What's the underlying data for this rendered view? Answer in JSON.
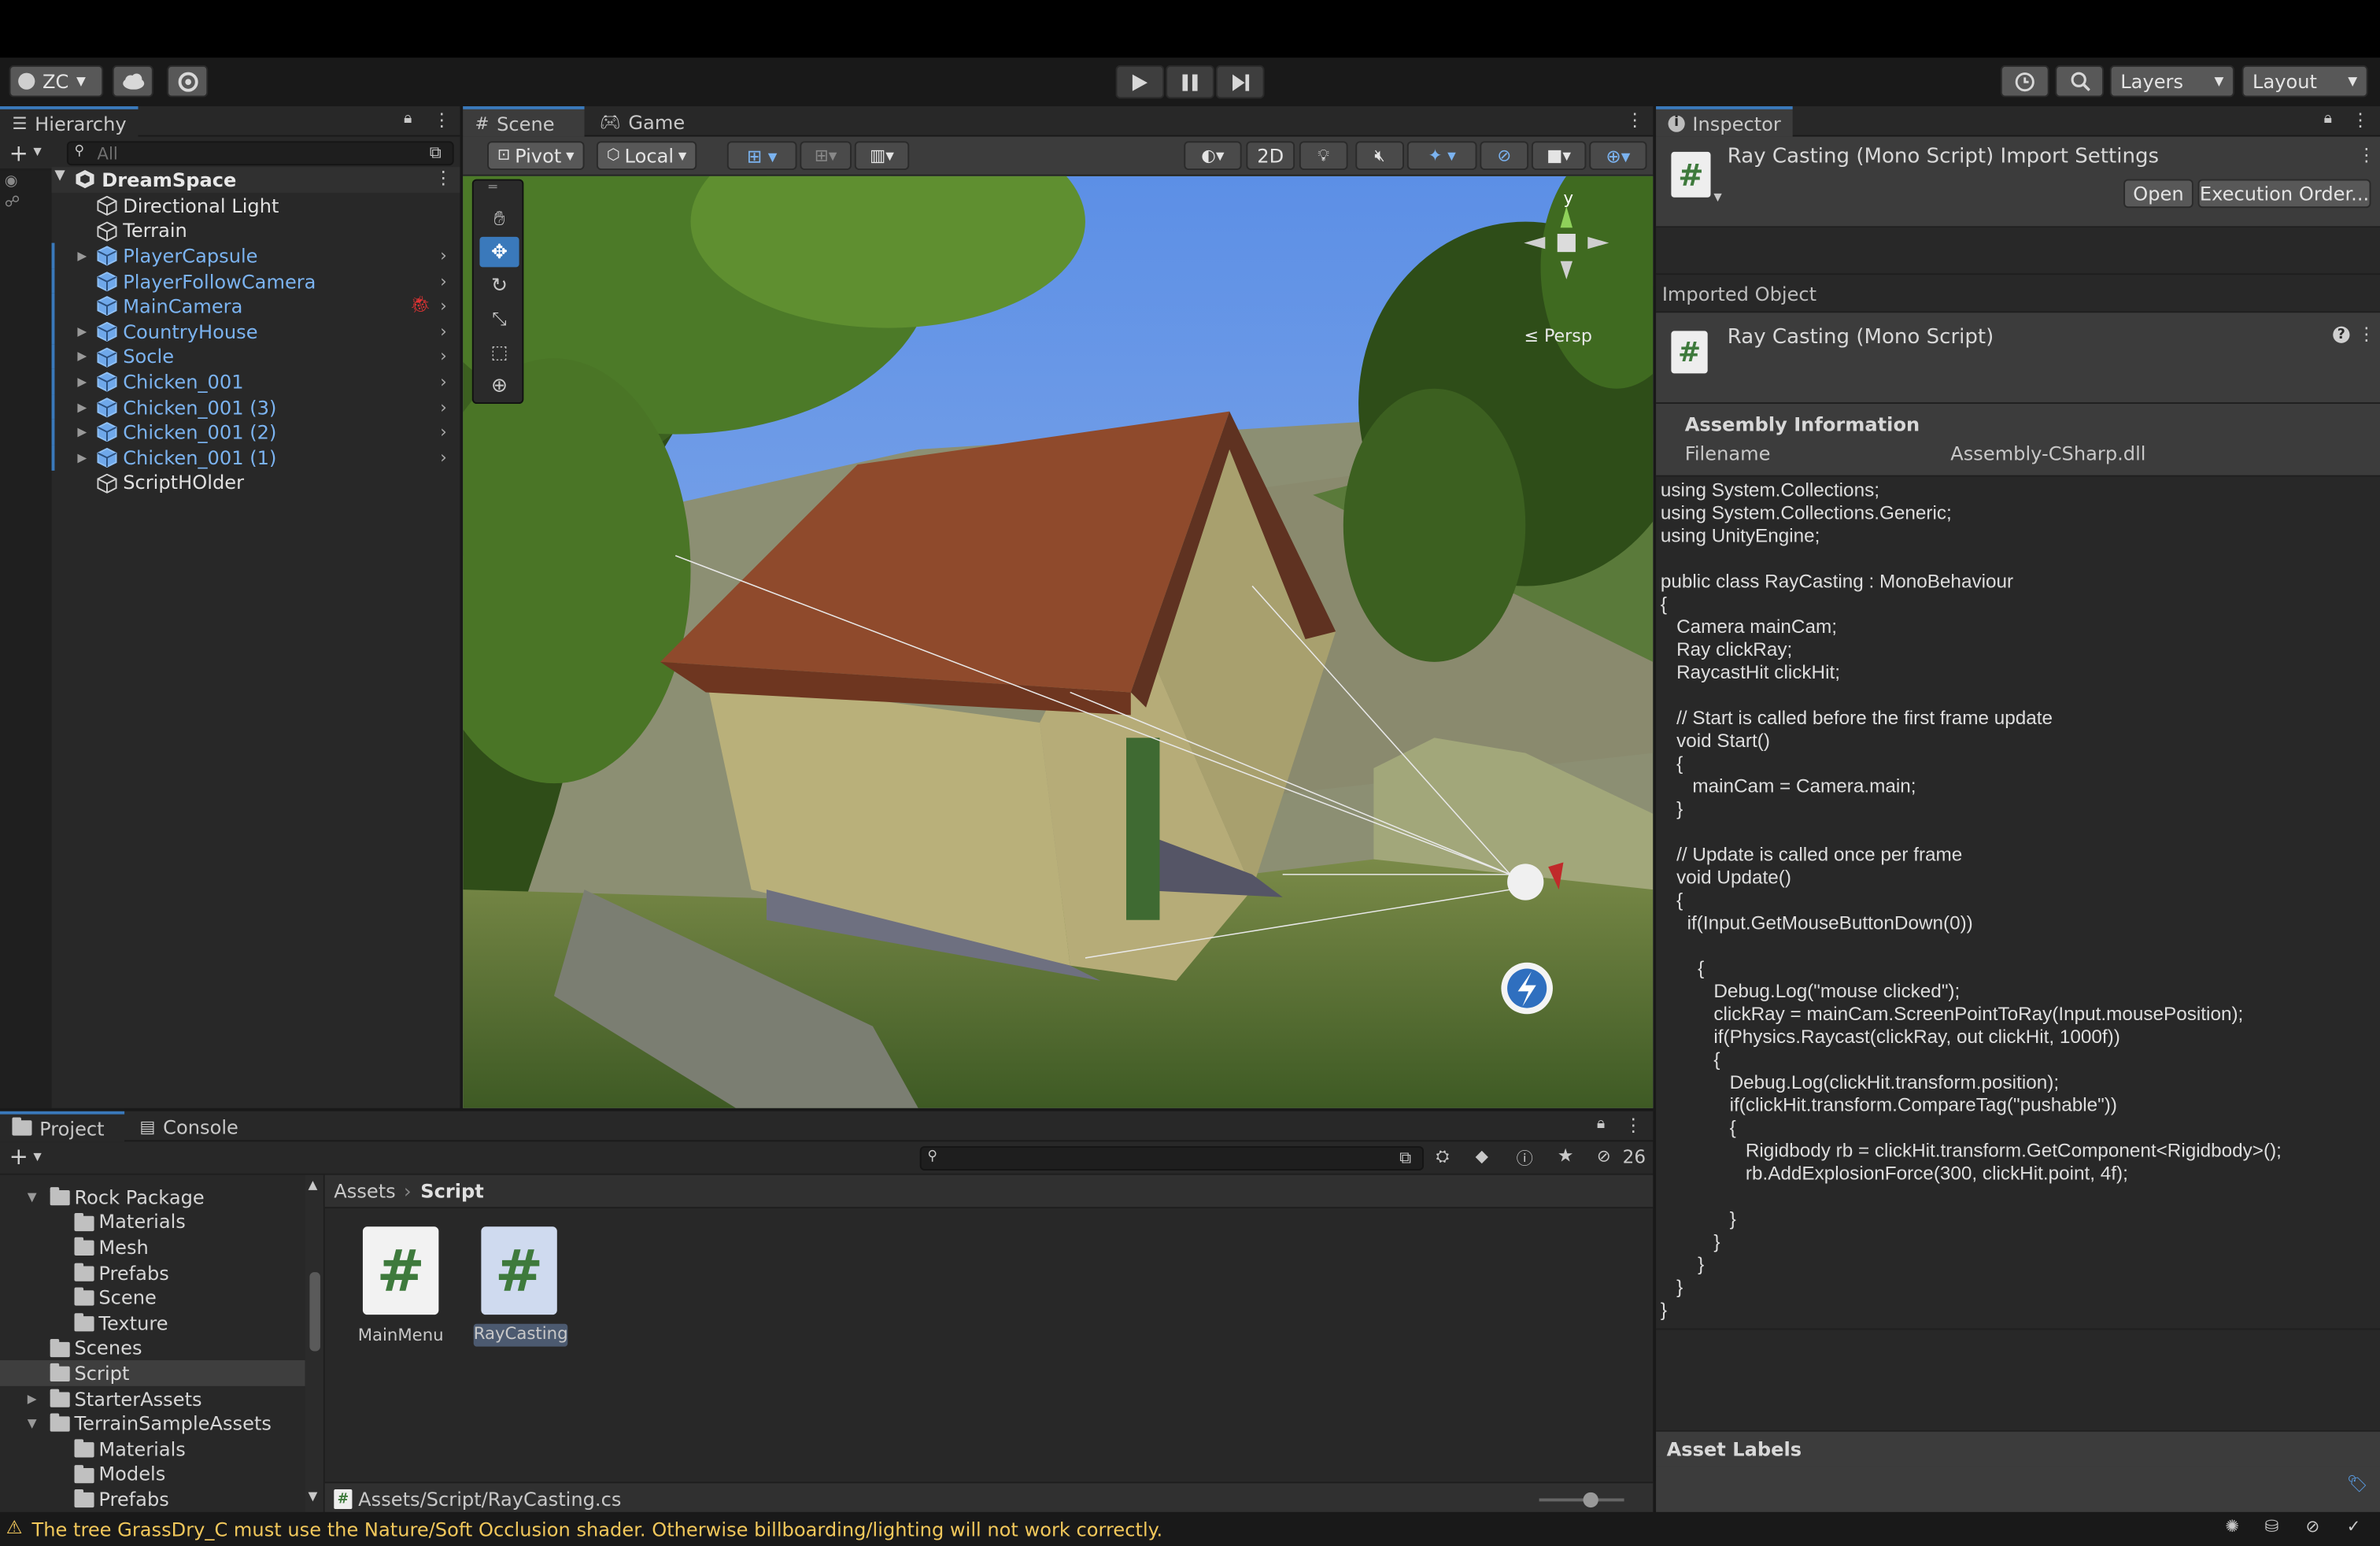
{
  "toolbar": {
    "account": "ZC",
    "layers": "Layers",
    "layout": "Layout"
  },
  "hierarchy": {
    "tab": "Hierarchy",
    "search_placeholder": "All",
    "scene_name": "DreamSpace",
    "items": [
      {
        "label": "Directional Light",
        "prefab": false,
        "expandable": false
      },
      {
        "label": "Terrain",
        "prefab": false,
        "expandable": false
      },
      {
        "label": "PlayerCapsule",
        "prefab": true,
        "expandable": true
      },
      {
        "label": "PlayerFollowCamera",
        "prefab": true,
        "expandable": false
      },
      {
        "label": "MainCamera",
        "prefab": true,
        "expandable": false
      },
      {
        "label": "CountryHouse",
        "prefab": true,
        "expandable": true
      },
      {
        "label": "Socle",
        "prefab": true,
        "expandable": true
      },
      {
        "label": "Chicken_001",
        "prefab": true,
        "expandable": true
      },
      {
        "label": "Chicken_001 (3)",
        "prefab": true,
        "expandable": true
      },
      {
        "label": "Chicken_001 (2)",
        "prefab": true,
        "expandable": true
      },
      {
        "label": "Chicken_001 (1)",
        "prefab": true,
        "expandable": true
      },
      {
        "label": "ScriptHOlder",
        "prefab": false,
        "expandable": false
      }
    ]
  },
  "scene": {
    "tabs": [
      "Scene",
      "Game"
    ],
    "pivot": "Pivot",
    "local": "Local",
    "mode_2d": "2D",
    "gizmo_y": "y",
    "persp": "≤ Persp"
  },
  "inspector": {
    "tab": "Inspector",
    "title": "Ray Casting (Mono Script) Import Settings",
    "open_button": "Open",
    "execution_order_button": "Execution Order...",
    "imported_object_header": "Imported Object",
    "object_name": "Ray Casting (Mono Script)",
    "assembly_header": "Assembly Information",
    "filename_label": "Filename",
    "filename_value": "Assembly-CSharp.dll",
    "code": "using System.Collections;\nusing System.Collections.Generic;\nusing UnityEngine;\n\npublic class RayCasting : MonoBehaviour\n{\n   Camera mainCam;\n   Ray clickRay;\n   RaycastHit clickHit;\n\n   // Start is called before the first frame update\n   void Start()\n   {\n      mainCam = Camera.main;\n   }\n\n   // Update is called once per frame\n   void Update()\n   {\n     if(Input.GetMouseButtonDown(0))\n\n       {\n          Debug.Log(\"mouse clicked\");\n          clickRay = mainCam.ScreenPointToRay(Input.mousePosition);\n          if(Physics.Raycast(clickRay, out clickHit, 1000f))\n          {\n             Debug.Log(clickHit.transform.position);\n             if(clickHit.transform.CompareTag(\"pushable\"))\n             {\n                Rigidbody rb = clickHit.transform.GetComponent<Rigidbody>();\n                rb.AddExplosionForce(300, clickHit.point, 4f);\n\n             }\n          }\n       }\n   }\n}",
    "asset_labels": "Asset Labels"
  },
  "project": {
    "tabs": [
      "Project",
      "Console"
    ],
    "hidden_count": "26",
    "breadcrumb": [
      "Assets",
      "Script"
    ],
    "tree": [
      {
        "label": "Rock Package",
        "depth": 1,
        "open": true
      },
      {
        "label": "Materials",
        "depth": 2
      },
      {
        "label": "Mesh",
        "depth": 2
      },
      {
        "label": "Prefabs",
        "depth": 2
      },
      {
        "label": "Scene",
        "depth": 2
      },
      {
        "label": "Texture",
        "depth": 2
      },
      {
        "label": "Scenes",
        "depth": 1
      },
      {
        "label": "Script",
        "depth": 1,
        "selected": true
      },
      {
        "label": "StarterAssets",
        "depth": 1,
        "closed": true
      },
      {
        "label": "TerrainSampleAssets",
        "depth": 1,
        "open": true
      },
      {
        "label": "Materials",
        "depth": 2
      },
      {
        "label": "Models",
        "depth": 2
      },
      {
        "label": "Prefabs",
        "depth": 2
      }
    ],
    "assets": [
      "MainMenu",
      "RayCasting"
    ],
    "path": "Assets/Script/RayCasting.cs"
  },
  "status": {
    "warning": "The tree GrassDry_C must use the Nature/Soft Occlusion shader. Otherwise billboarding/lighting will not work correctly."
  },
  "colors": {
    "accent": "#3a79bb",
    "prefab_blue": "#7bb3f0",
    "script_green": "#3e7a3c",
    "warning_yellow": "#f2c85b"
  }
}
